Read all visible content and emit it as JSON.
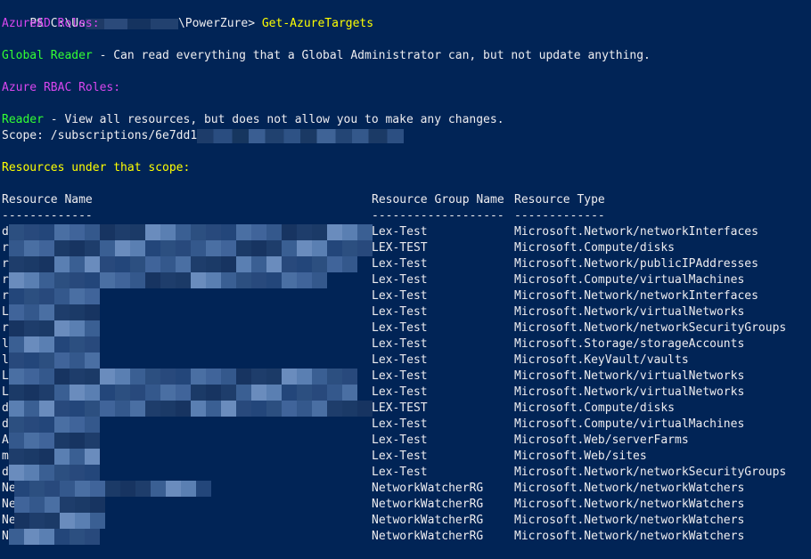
{
  "prompt": {
    "prefix": "PS C:\\Us",
    "suffix": "\\PowerZure>",
    "command": "Get-AzureTargets"
  },
  "azuread_heading": "AzureAD Roles:",
  "global_reader": {
    "role": "Global Reader",
    "description": " - Can read everything that a Global Administrator can, but not update anything."
  },
  "rbac_heading": "Azure RBAC Roles:",
  "reader": {
    "role": "Reader",
    "description": " - View all resources, but does not allow you to make any changes."
  },
  "scope_line": "Scope: /subscriptions/6e7dd1",
  "resources_heading": "Resources under that scope:",
  "table": {
    "headers": [
      "Resource Name",
      "Resource Group Name",
      "Resource Type"
    ],
    "underlines": [
      "-------------",
      "-------------------",
      "-------------"
    ],
    "rows": [
      {
        "name": "d",
        "group": "Lex-Test",
        "type": "Microsoft.Network/networkInterfaces"
      },
      {
        "name": "r",
        "group": "LEX-TEST",
        "type": "Microsoft.Compute/disks"
      },
      {
        "name": "r",
        "group": "Lex-Test",
        "type": "Microsoft.Network/publicIPAddresses"
      },
      {
        "name": "r",
        "group": "Lex-Test",
        "type": "Microsoft.Compute/virtualMachines"
      },
      {
        "name": "r",
        "group": "Lex-Test",
        "type": "Microsoft.Network/networkInterfaces"
      },
      {
        "name": "L",
        "group": "Lex-Test",
        "type": "Microsoft.Network/virtualNetworks"
      },
      {
        "name": "r",
        "group": "Lex-Test",
        "type": "Microsoft.Network/networkSecurityGroups"
      },
      {
        "name": "l",
        "group": "Lex-Test",
        "type": "Microsoft.Storage/storageAccounts"
      },
      {
        "name": "l",
        "group": "Lex-Test",
        "type": "Microsoft.KeyVault/vaults"
      },
      {
        "name": "L",
        "group": "Lex-Test",
        "type": "Microsoft.Network/virtualNetworks"
      },
      {
        "name": "L",
        "group": "Lex-Test",
        "type": "Microsoft.Network/virtualNetworks"
      },
      {
        "name": "d",
        "group": "LEX-TEST",
        "type": "Microsoft.Compute/disks"
      },
      {
        "name": "d",
        "group": "Lex-Test",
        "type": "Microsoft.Compute/virtualMachines"
      },
      {
        "name": "A",
        "group": "Lex-Test",
        "type": "Microsoft.Web/serverFarms"
      },
      {
        "name": "m",
        "group": "Lex-Test",
        "type": "Microsoft.Web/sites"
      },
      {
        "name": "d",
        "group": "Lex-Test",
        "type": "Microsoft.Network/networkSecurityGroups"
      },
      {
        "name": "Ne",
        "group": "NetworkWatcherRG",
        "type": "Microsoft.Network/networkWatchers"
      },
      {
        "name": "Ne",
        "group": "NetworkWatcherRG",
        "type": "Microsoft.Network/networkWatchers"
      },
      {
        "name": "Ne",
        "group": "NetworkWatcherRG",
        "type": "Microsoft.Network/networkWatchers"
      },
      {
        "name": "N",
        "group": "NetworkWatcherRG",
        "type": "Microsoft.Network/networkWatchers"
      }
    ]
  },
  "colors": {
    "background": "#012456",
    "text": "#eeedf0",
    "prompt_command": "#ffff00",
    "heading_magenta": "#d946ef",
    "role_green": "#33ff33",
    "resources_heading": "#ffff00"
  }
}
